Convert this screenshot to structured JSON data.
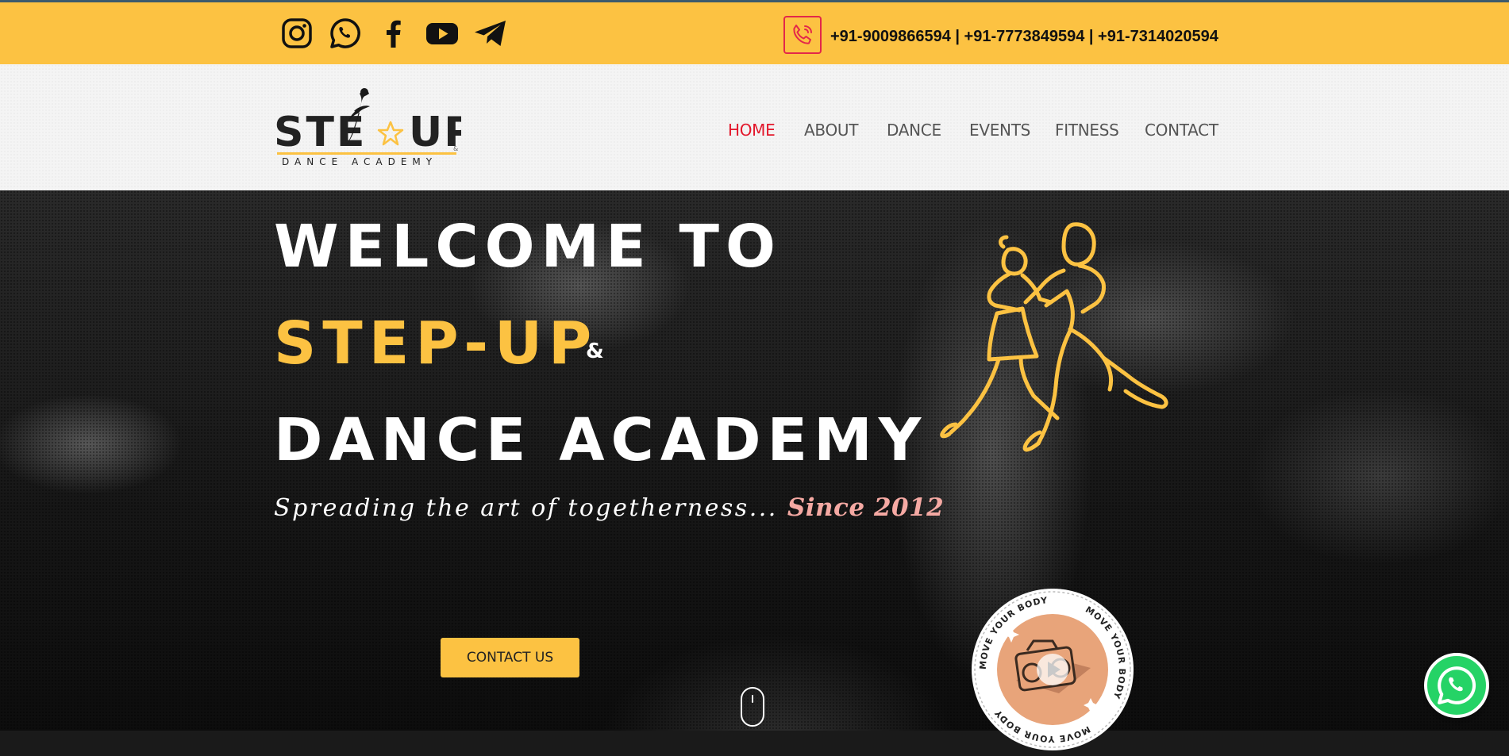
{
  "topbar": {
    "social_icons": [
      "instagram-icon",
      "whatsapp-icon",
      "facebook-icon",
      "youtube-icon",
      "telegram-icon"
    ],
    "phone_icon": "phone-call-icon",
    "phones": "+91-9009866594 | +91-7773849594 | +91-7314020594"
  },
  "logo": {
    "word_left": "STE",
    "word_right": "UP",
    "small_amp": "&",
    "sub": "DANCE ACADEMY"
  },
  "nav": {
    "items": [
      "HOME",
      "ABOUT",
      "DANCE",
      "EVENTS",
      "FITNESS",
      "CONTACT"
    ],
    "active": "HOME"
  },
  "hero": {
    "line1": "WELCOME TO",
    "line2": "STEP-UP",
    "amp": "&",
    "line3": "DANCE ACADEMY",
    "tagline": "Spreading the art of togetherness...",
    "since": "Since 2012",
    "cta_label": "CONTACT US",
    "badge_text": "MOVE YOUR BODY"
  },
  "colors": {
    "accent_yellow": "#fcc242",
    "nav_active": "#e3172b",
    "since_pink": "#f5a9a3",
    "whatsapp_green": "#25d366"
  }
}
